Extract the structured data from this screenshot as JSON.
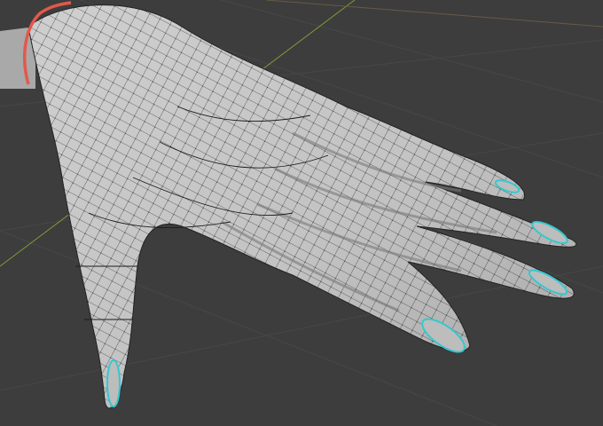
{
  "viewport": {
    "mode": "edit-mode",
    "object": "hand-mesh",
    "colors": {
      "background": "#3d3d3d",
      "grid_line": "#474747",
      "grid_axis_x": "#6a5a45",
      "grid_axis_y": "#7f9a35",
      "mesh_surface": "#c6c6c6",
      "mesh_shadow": "#8f8f8f",
      "wire": "#111111",
      "seam_red": "#e2584d",
      "seam_cyan": "#35c8cf"
    }
  }
}
